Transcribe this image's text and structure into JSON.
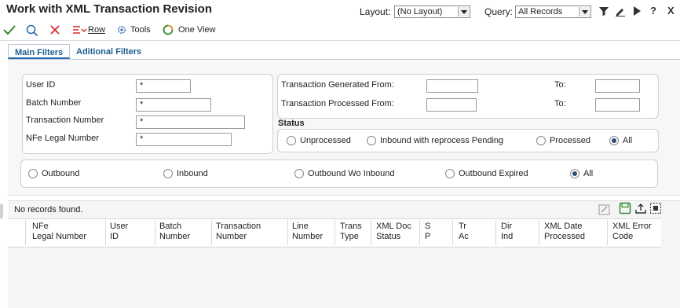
{
  "header": {
    "title": "Work with XML Transaction Revision",
    "layout_label": "Layout:",
    "layout_value": "(No Layout)",
    "query_label": "Query:",
    "query_value": "All Records"
  },
  "toolbar": {
    "row_label": "Row",
    "tools_label": "Tools",
    "one_view_label": "One View"
  },
  "tabs": [
    "Main Filters",
    "Aditional Filters"
  ],
  "filters": {
    "user_id_label": "User ID",
    "user_id_value": "*",
    "batch_number_label": "Batch Number",
    "batch_number_value": "*",
    "transaction_number_label": "Transaction Number",
    "transaction_number_value": "*",
    "nfe_legal_number_label": "NFe Legal Number",
    "nfe_legal_number_value": "*",
    "generated_from_label": "Transaction Generated From:",
    "processed_from_label": "Transaction Processed From:",
    "to_label": "To:",
    "status_label": "Status",
    "status_options": [
      "Unprocessed",
      "Inbound with reprocess Pending",
      "Processed",
      "All"
    ],
    "status_selected": "All",
    "direction_options": [
      "Outbound",
      "Inbound",
      "Outbound Wo Inbound",
      "Outbound Expired",
      "All"
    ],
    "direction_selected": "All"
  },
  "grid": {
    "message": "No records found.",
    "columns": [
      {
        "line1": "NFe",
        "line2": "Legal Number"
      },
      {
        "line1": "User",
        "line2": "ID"
      },
      {
        "line1": "Batch",
        "line2": "Number"
      },
      {
        "line1": "Transaction",
        "line2": "Number"
      },
      {
        "line1": "Line",
        "line2": "Number"
      },
      {
        "line1": "Trans",
        "line2": "Type"
      },
      {
        "line1": "XML Doc",
        "line2": "Status"
      },
      {
        "line1": "S",
        "line2": "P"
      },
      {
        "line1": "Tr",
        "line2": "Ac"
      },
      {
        "line1": "Dir",
        "line2": "Ind"
      },
      {
        "line1": "XML Date",
        "line2": "Processed"
      },
      {
        "line1": "XML Error",
        "line2": "Code"
      }
    ]
  },
  "colors": {
    "accent": "#1b5d8f",
    "ok_green": "#2e8b2e",
    "cancel_red": "#d9262b"
  }
}
